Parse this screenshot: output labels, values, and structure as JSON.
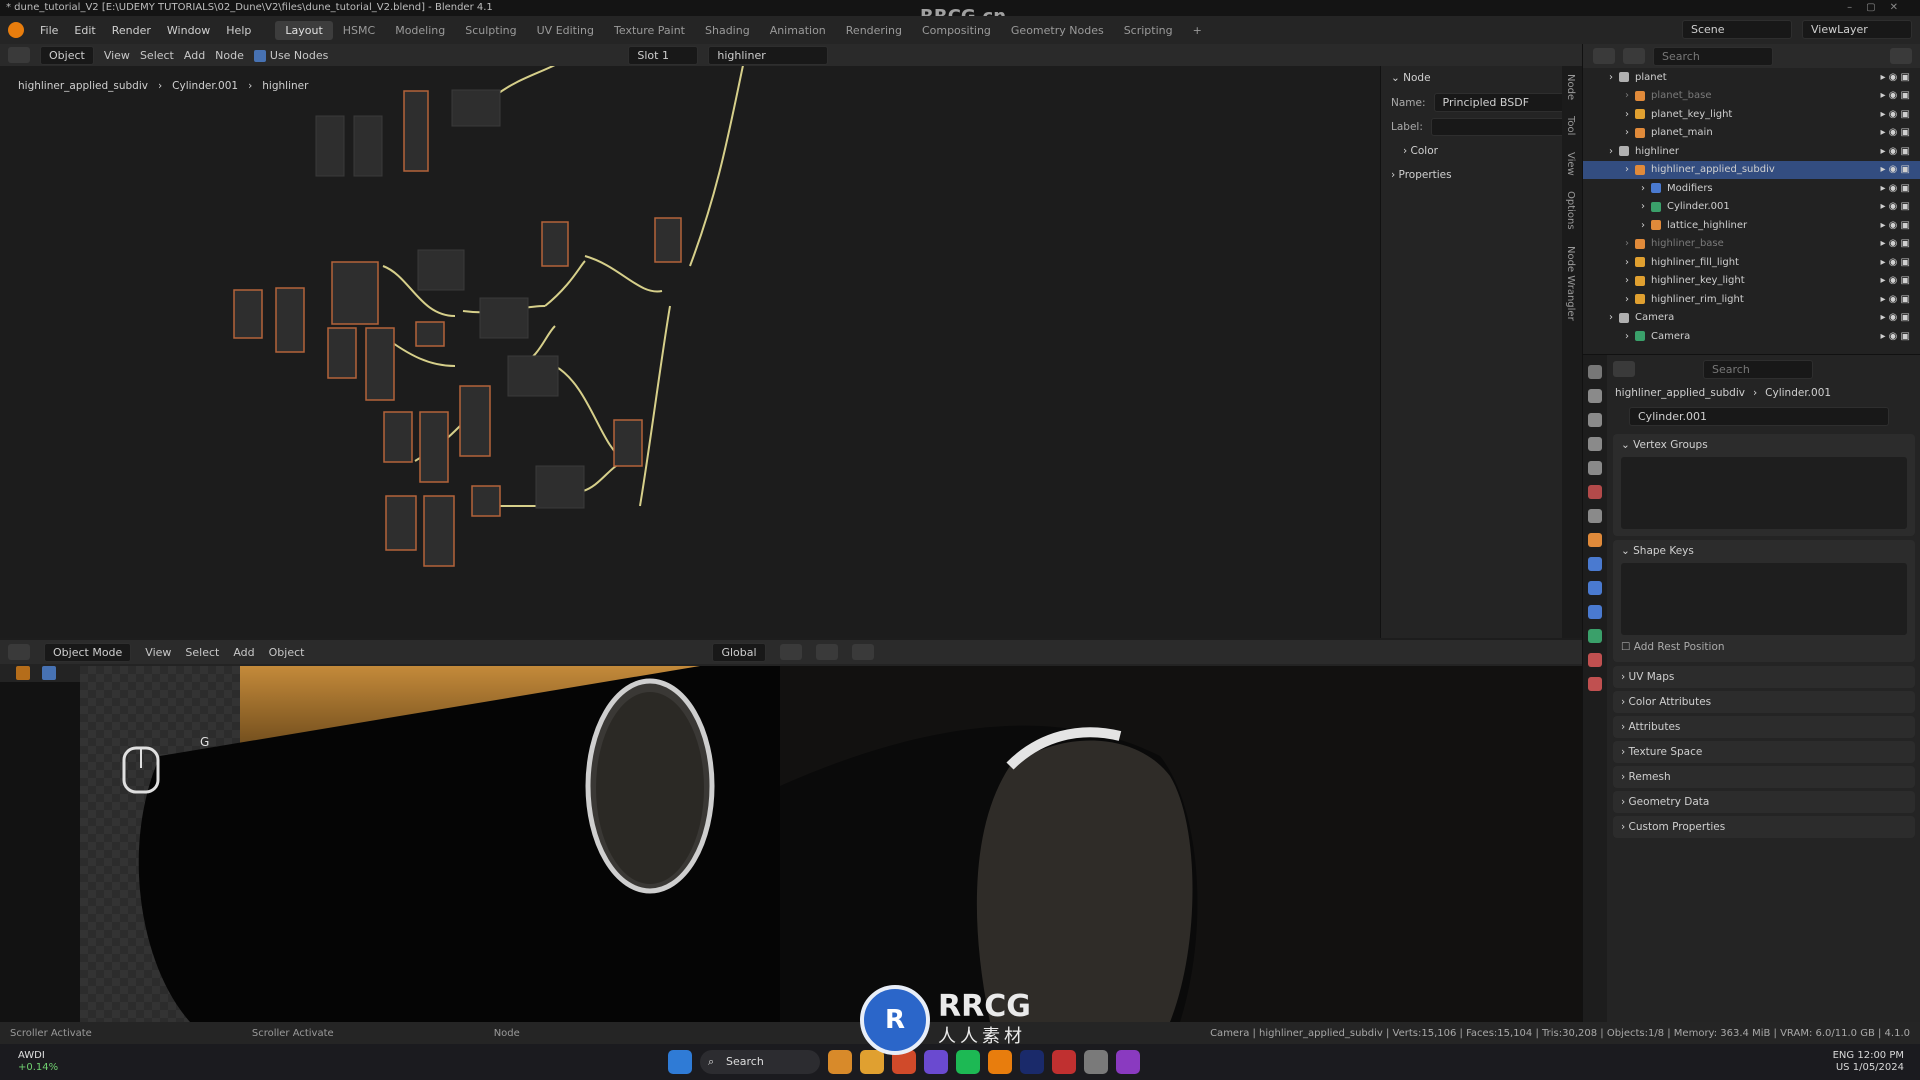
{
  "window": {
    "title": "* dune_tutorial_V2 [E:\\UDEMY TUTORIALS\\02_Dune\\V2\\files\\dune_tutorial_V2.blend] - Blender 4.1"
  },
  "watermark": {
    "top": "RRCG.cn",
    "logo_big": "RRCG",
    "logo_small": "人人素材"
  },
  "menu": {
    "items": [
      "File",
      "Edit",
      "Render",
      "Window",
      "Help"
    ],
    "workspaces": [
      "Layout",
      "HSMC",
      "Modeling",
      "Sculpting",
      "UV Editing",
      "Texture Paint",
      "Shading",
      "Animation",
      "Rendering",
      "Compositing",
      "Geometry Nodes",
      "Scripting"
    ],
    "active_workspace": "Layout",
    "scene": "Scene",
    "view_layer": "ViewLayer"
  },
  "node_editor": {
    "mode": "Object",
    "menus": [
      "View",
      "Select",
      "Add",
      "Node"
    ],
    "use_nodes_label": "Use Nodes",
    "slot": "Slot 1",
    "material": "highliner",
    "breadcrumb": [
      "highliner_applied_subdiv",
      "Cylinder.001",
      "highliner"
    ]
  },
  "node_panel": {
    "section": "Node",
    "name_label": "Name:",
    "name_value": "Principled BSDF",
    "label_label": "Label:",
    "label_value": "",
    "color_label": "Color",
    "properties_label": "Properties",
    "tabs": [
      "Node",
      "Tool",
      "View",
      "Options",
      "Node Wrangler"
    ]
  },
  "viewport": {
    "mode": "Object Mode",
    "menus": [
      "View",
      "Select",
      "Add",
      "Object"
    ],
    "orientation": "Global",
    "overlay_key": "G"
  },
  "outliner": {
    "search_placeholder": "Search",
    "rows": [
      {
        "label": "planet",
        "kind": "collection",
        "selected": false,
        "dim": false,
        "indent": 1
      },
      {
        "label": "planet_base",
        "kind": "mesh",
        "selected": false,
        "dim": true,
        "indent": 2
      },
      {
        "label": "planet_key_light",
        "kind": "light",
        "selected": false,
        "dim": false,
        "indent": 2
      },
      {
        "label": "planet_main",
        "kind": "mesh",
        "selected": false,
        "dim": false,
        "indent": 2
      },
      {
        "label": "highliner",
        "kind": "collection",
        "selected": false,
        "dim": false,
        "indent": 1
      },
      {
        "label": "highliner_applied_subdiv",
        "kind": "mesh",
        "selected": true,
        "dim": false,
        "indent": 2
      },
      {
        "label": "Modifiers",
        "kind": "modifier",
        "selected": false,
        "dim": false,
        "indent": 3
      },
      {
        "label": "Cylinder.001",
        "kind": "data",
        "selected": false,
        "dim": false,
        "indent": 3
      },
      {
        "label": "lattice_highliner",
        "kind": "lattice",
        "selected": false,
        "dim": false,
        "indent": 3
      },
      {
        "label": "highliner_base",
        "kind": "mesh",
        "selected": false,
        "dim": true,
        "indent": 2
      },
      {
        "label": "highliner_fill_light",
        "kind": "light",
        "selected": false,
        "dim": false,
        "indent": 2
      },
      {
        "label": "highliner_key_light",
        "kind": "light",
        "selected": false,
        "dim": false,
        "indent": 2
      },
      {
        "label": "highliner_rim_light",
        "kind": "light",
        "selected": false,
        "dim": false,
        "indent": 2
      },
      {
        "label": "Camera",
        "kind": "collection",
        "selected": false,
        "dim": false,
        "indent": 1
      },
      {
        "label": "Camera",
        "kind": "camera",
        "selected": false,
        "dim": false,
        "indent": 2
      }
    ]
  },
  "properties": {
    "search_placeholder": "Search",
    "breadcrumb": [
      "highliner_applied_subdiv",
      "Cylinder.001"
    ],
    "data_name": "Cylinder.001",
    "panels_open": [
      "Vertex Groups",
      "Shape Keys"
    ],
    "add_rest_position": "Add Rest Position",
    "panels_collapsed": [
      "UV Maps",
      "Color Attributes",
      "Attributes",
      "Texture Space",
      "Remesh",
      "Geometry Data",
      "Custom Properties"
    ]
  },
  "statusbar": {
    "left1": "Scroller Activate",
    "left2": "Scroller Activate",
    "left3": "Node",
    "stats": "Camera | highliner_applied_subdiv | Verts:15,106 | Faces:15,104 | Tris:30,208 | Objects:1/8 | Memory: 363.4 MiB | VRAM: 6.0/11.0 GB | 4.1.0"
  },
  "taskbar": {
    "weather_temp": "AWDI",
    "weather_sub": "+0.14%",
    "search": "Search",
    "lang": "ENG",
    "region": "US",
    "time": "12:00 PM",
    "date": "1/05/2024"
  },
  "colors": {
    "accent": "#4772b3",
    "selection": "#334d80",
    "node_frame": "#b3633a",
    "wire": "#d6cf8a"
  }
}
